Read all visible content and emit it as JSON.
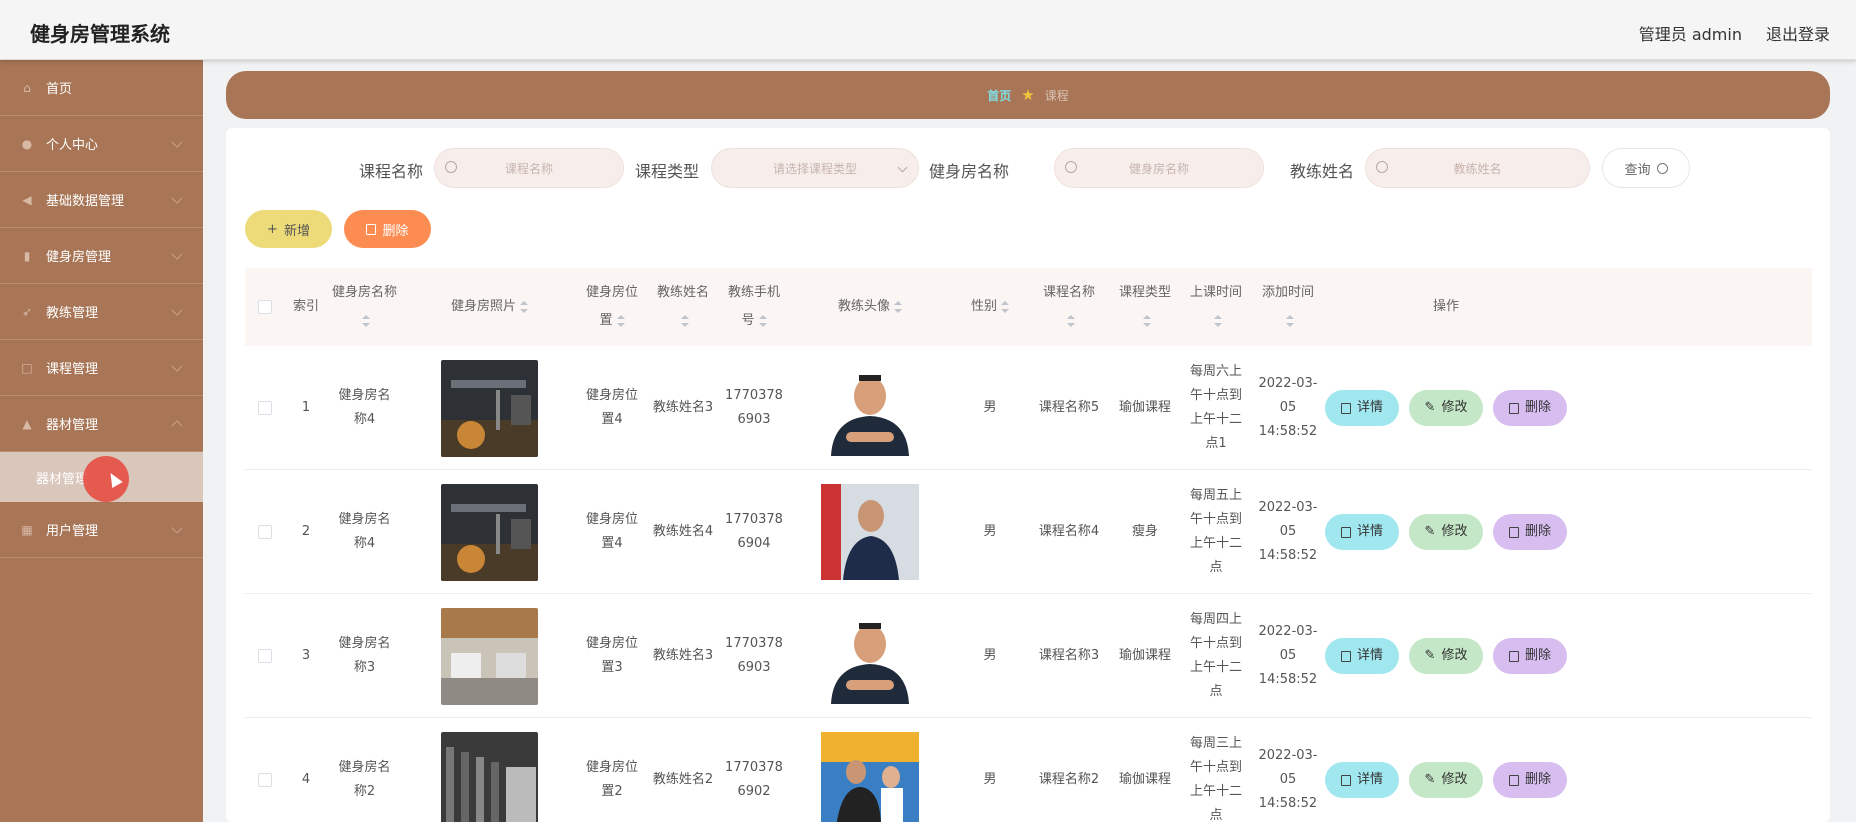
{
  "app": {
    "title": "健身房管理系统"
  },
  "header": {
    "user_label": "管理员 admin",
    "logout_label": "退出登录"
  },
  "sidebar": {
    "items": [
      {
        "label": "首页",
        "icon": "home-icon"
      },
      {
        "label": "个人中心",
        "icon": "user-icon"
      },
      {
        "label": "基础数据管理",
        "icon": "data-icon"
      },
      {
        "label": "健身房管理",
        "icon": "gym-icon"
      },
      {
        "label": "教练管理",
        "icon": "coach-icon"
      },
      {
        "label": "课程管理",
        "icon": "course-icon"
      },
      {
        "label": "器材管理",
        "icon": "equipment-icon"
      }
    ],
    "sub_item": {
      "label": "器材管理"
    },
    "last_item": {
      "label": "用户管理",
      "icon": "users-icon"
    }
  },
  "breadcrumb": {
    "home": "首页",
    "current": "课程"
  },
  "search": {
    "course_name_label": "课程名称",
    "course_name_placeholder": "课程名称",
    "course_type_label": "课程类型",
    "course_type_placeholder": "请选择课程类型",
    "gym_name_label": "健身房名称",
    "gym_name_placeholder": "健身房名称",
    "coach_name_label": "教练姓名",
    "coach_name_placeholder": "教练姓名",
    "query_label": "查询"
  },
  "actions": {
    "add_label": "新增",
    "delete_label": "删除"
  },
  "table": {
    "headers": {
      "index": "索引",
      "gym_name": "健身房名称",
      "gym_photo": "健身房照片",
      "gym_location": "健身房位置",
      "coach_name": "教练姓名",
      "coach_phone": "教练手机号",
      "coach_avatar": "教练头像",
      "gender": "性别",
      "course_name": "课程名称",
      "course_type": "课程类型",
      "class_time": "上课时间",
      "add_time": "添加时间",
      "ops": "操作"
    },
    "ops_labels": {
      "detail": "详情",
      "edit": "修改",
      "delete": "删除"
    },
    "rows": [
      {
        "index": "1",
        "gym_name": "健身房名称4",
        "gym_location": "健身房位置4",
        "coach_name": "教练姓名3",
        "coach_phone": "17703786903",
        "gender": "男",
        "course_name": "课程名称5",
        "course_type": "瑜伽课程",
        "class_time": "每周六上午十点到上午十二点1",
        "add_time": "2022-03-05 14:58:52"
      },
      {
        "index": "2",
        "gym_name": "健身房名称4",
        "gym_location": "健身房位置4",
        "coach_name": "教练姓名4",
        "coach_phone": "17703786904",
        "gender": "男",
        "course_name": "课程名称4",
        "course_type": "瘦身",
        "class_time": "每周五上午十点到上午十二点",
        "add_time": "2022-03-05 14:58:52"
      },
      {
        "index": "3",
        "gym_name": "健身房名称3",
        "gym_location": "健身房位置3",
        "coach_name": "教练姓名3",
        "coach_phone": "17703786903",
        "gender": "男",
        "course_name": "课程名称3",
        "course_type": "瑜伽课程",
        "class_time": "每周四上午十点到上午十二点",
        "add_time": "2022-03-05 14:58:52"
      },
      {
        "index": "4",
        "gym_name": "健身房名称2",
        "gym_location": "健身房位置2",
        "coach_name": "教练姓名2",
        "coach_phone": "17703786902",
        "gender": "男",
        "course_name": "课程名称2",
        "course_type": "瑜伽课程",
        "class_time": "每周三上午十点到上午十二点",
        "add_time": "2022-03-05 14:58:52"
      }
    ]
  },
  "colors": {
    "brand": "#a87556",
    "accent_link": "#7fe0e6"
  }
}
